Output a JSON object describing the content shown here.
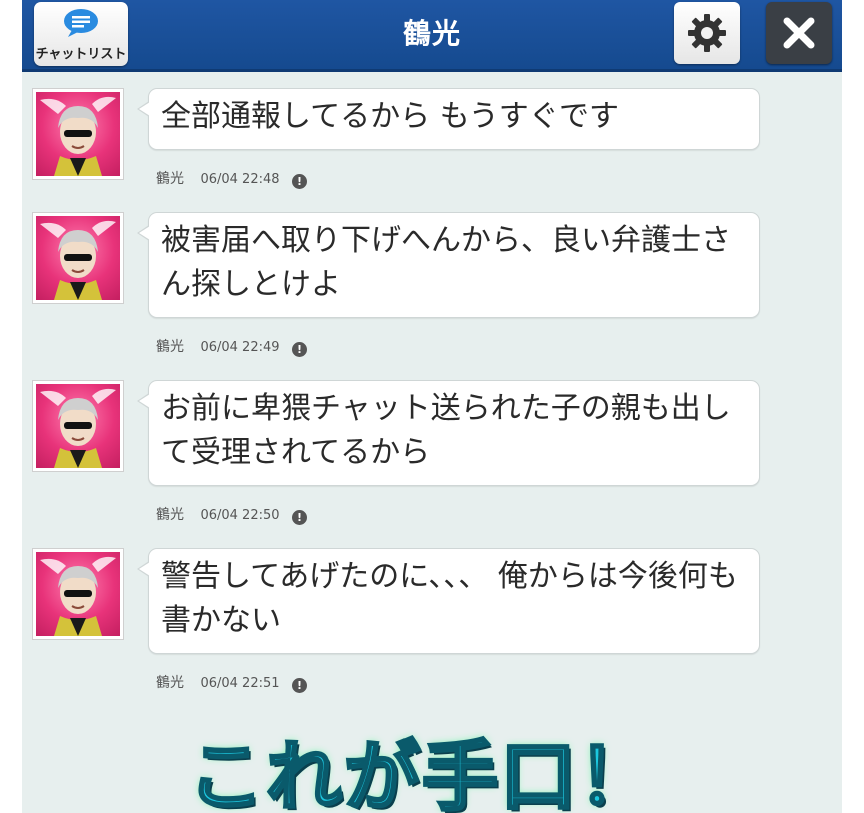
{
  "header": {
    "title": "鶴光",
    "chatlist_label": "チャットリスト",
    "chatlist_icon": "chat-bubble-icon",
    "settings_icon": "gear-icon",
    "close_icon": "close-icon"
  },
  "messages": [
    {
      "sender": "鶴光",
      "text": "全部通報してるから もうすぐです",
      "time": "06/04 22:48",
      "status_icon": "!"
    },
    {
      "sender": "鶴光",
      "text": "被害届へ取り下げへんから、良い弁護士さん探しとけよ",
      "time": "06/04 22:49",
      "status_icon": "!"
    },
    {
      "sender": "鶴光",
      "text": "お前に卑猥チャット送られた子の親も出して受理されてるから",
      "time": "06/04 22:50",
      "status_icon": "!"
    },
    {
      "sender": "鶴光",
      "text": "警告してあげたのに、、、 俺からは今後何も書かない",
      "time": "06/04 22:51",
      "status_icon": "!"
    }
  ],
  "caption": "これが手口！",
  "colors": {
    "header_bg": "#1f56a3",
    "chat_bg": "#e7efee",
    "caption": "#1cc8e0"
  }
}
